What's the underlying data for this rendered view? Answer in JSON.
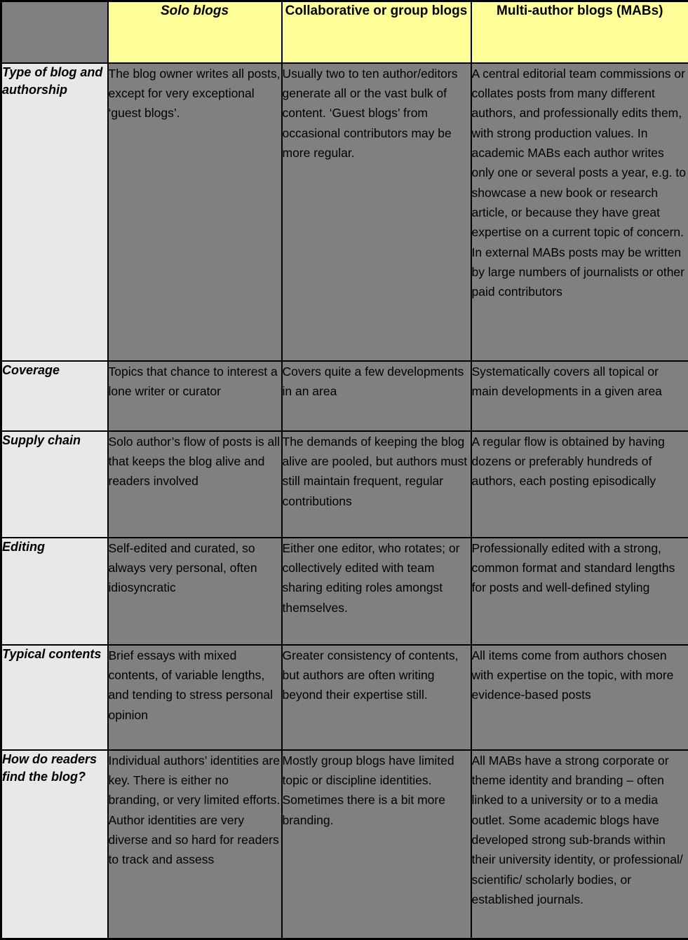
{
  "table": {
    "columns": [
      {
        "key": "label",
        "label": "",
        "style": "blank"
      },
      {
        "key": "solo",
        "label": "Solo blogs",
        "style": "italic"
      },
      {
        "key": "group",
        "label": "Collaborative or group blogs",
        "style": "bold"
      },
      {
        "key": "mab",
        "label": "Multi-author blogs (MABs)",
        "style": "bold"
      }
    ],
    "colors": {
      "header_background": "#FFFF99",
      "row_label_background": "#E8E8E8",
      "data_cell_background": "#808080",
      "border": "#000000",
      "text": "#000000"
    },
    "rows": [
      {
        "label": "Type of blog and authorship",
        "solo": "The blog owner writes all posts, except for very exceptional ‘guest blogs’.",
        "group": "Usually two to ten author/editors generate all or the vast bulk of content. ‘Guest blogs’ from occasional contributors may be more regular.",
        "mab": "A central editorial team commissions or collates posts from many different authors, and professionally edits them, with strong production values. In academic MABs each author writes only one or several posts a year, e.g. to showcase a new book or research article, or because they have great expertise on a current topic of concern. In external MABs posts may be written by large numbers of journalists or other paid contributors"
      },
      {
        "label": "Coverage",
        "solo": "Topics that chance to interest a lone writer or curator",
        "group": "Covers quite a few developments in an area",
        "mab": "Systematically covers all topical or main developments in a given area"
      },
      {
        "label": "Supply chain",
        "solo": "Solo author’s flow of posts is all that keeps the blog alive and readers involved",
        "group": "The demands of keeping the blog alive are pooled, but authors must still maintain frequent, regular contributions",
        "mab": "A regular flow is obtained by having dozens or preferably hundreds  of authors, each posting episodically"
      },
      {
        "label": "Editing",
        "solo": " Self-edited and curated, so always very personal, often idiosyncratic",
        "group": "Either one editor, who rotates; or collectively edited with team sharing editing roles amongst themselves.",
        "mab": "Professionally edited with a strong, common format and standard lengths for posts and well-defined styling"
      },
      {
        "label": "Typical contents",
        "solo": "Brief essays with mixed contents, of variable lengths, and tending to stress personal opinion",
        "group": "Greater consistency of contents, but authors are often writing beyond their expertise still.",
        "mab": "All items come from authors chosen with expertise on the topic, with more evidence-based posts"
      },
      {
        "label": "How do readers find the blog?",
        "solo": "Individual authors’ identities are key. There is either no branding, or very limited efforts. Author identities are very diverse and so hard for readers to track and assess",
        "group": "Mostly group blogs have limited topic or discipline identities. Sometimes there is a bit more branding.",
        "mab": "All MABs have a strong corporate or theme identity and branding – often linked to a university or to a media outlet. Some academic blogs have developed strong sub-brands within their university identity, or professional/ scientific/ scholarly bodies, or established journals."
      }
    ]
  }
}
